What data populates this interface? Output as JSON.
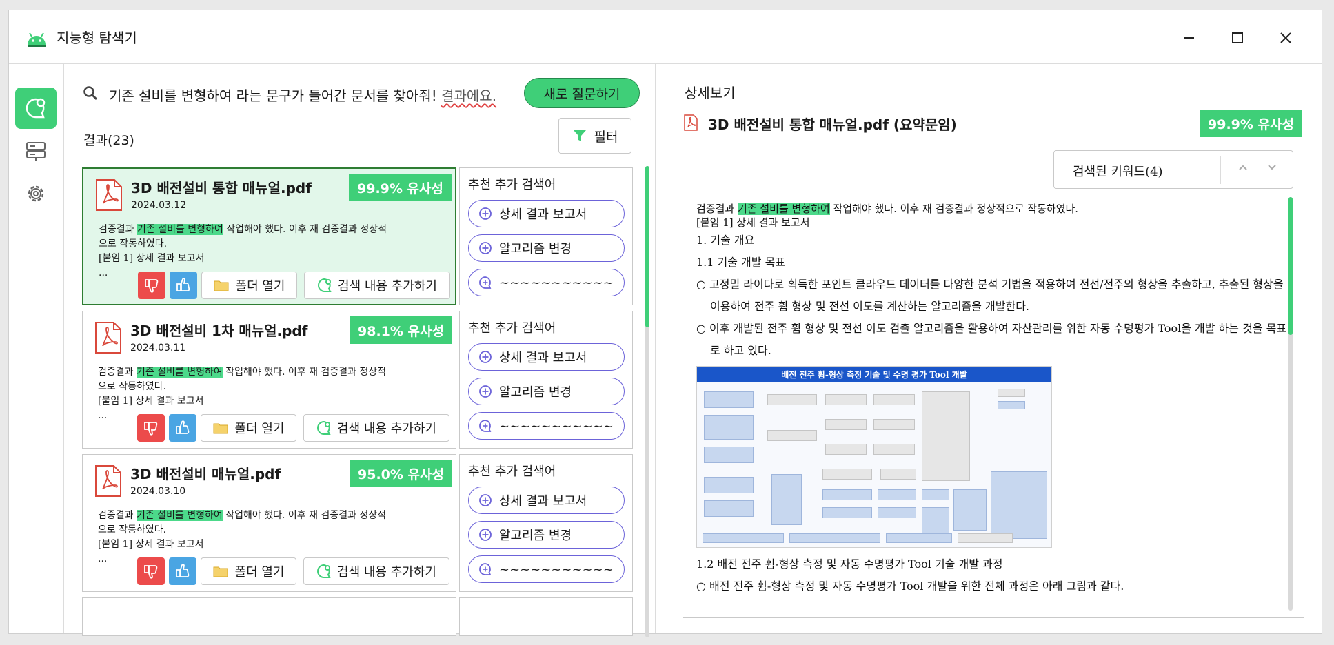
{
  "window": {
    "title": "지능형 탐색기"
  },
  "search": {
    "query": "기존 설비를 변형하여 라는 문구가 들어간 문서를 찾아줘!",
    "query_suffix": "결과에요.",
    "new_question_label": "새로 질문하기",
    "result_count": "결과(23)",
    "filter_label": "필터"
  },
  "results": [
    {
      "title": "3D 배전설비 통합 매뉴얼.pdf",
      "date": "2024.03.12",
      "similarity": "99.9% 유사성",
      "snippet_pre": "검증결과",
      "snippet_hl": "기존 설비를 변형하여",
      "snippet_post": "작업해야 했다. 이후 재 검증결과 정상적으로 작동하였다.",
      "snippet_line3": "[붙임 1] 상세 결과 보고서",
      "snippet_more": "...",
      "folder_label": "폴더 열기",
      "add_search_label": "검색 내용 추가하기"
    },
    {
      "title": "3D 배전설비 1차 매뉴얼.pdf",
      "date": "2024.03.11",
      "similarity": "98.1% 유사성",
      "snippet_pre": "검증결과",
      "snippet_hl": "기존 설비를 변형하여",
      "snippet_post": "작업해야 했다. 이후 재 검증결과 정상적으로 작동하였다.",
      "snippet_line3": "[붙임 1] 상세 결과 보고서",
      "snippet_more": "...",
      "folder_label": "폴더 열기",
      "add_search_label": "검색 내용 추가하기"
    },
    {
      "title": "3D 배전설비 매뉴얼.pdf",
      "date": "2024.03.10",
      "similarity": "95.0% 유사성",
      "snippet_pre": "검증결과",
      "snippet_hl": "기존 설비를 변형하여",
      "snippet_post": "작업해야 했다. 이후 재 검증결과 정상적으로 작동하였다.",
      "snippet_line3": "[붙임 1] 상세 결과 보고서",
      "snippet_more": "...",
      "folder_label": "폴더 열기",
      "add_search_label": "검색 내용 추가하기"
    }
  ],
  "recommendations": [
    {
      "title": "추천 추가 검색어",
      "items": [
        "상세 결과 보고서",
        "알고리즘 변경",
        "~~~~~~~~~~~"
      ]
    },
    {
      "title": "추천 추가 검색어",
      "items": [
        "상세 결과 보고서",
        "알고리즘 변경",
        "~~~~~~~~~~~"
      ]
    },
    {
      "title": "추천 추가 검색어",
      "items": [
        "상세 결과 보고서",
        "알고리즘 변경",
        "~~~~~~~~~~~"
      ]
    }
  ],
  "detail": {
    "heading": "상세보기",
    "doc_title": "3D 배전설비 통합 매뉴얼.pdf (요약문임)",
    "similarity": "99.9% 유사성",
    "keyword_label": "검색된 키워드(4)",
    "line1_pre": "검증결과",
    "line1_hl": "기존 설비를 변형하여",
    "line1_post": "작업해야 했다. 이후 재 검증결과 정상적으로 작동하였다.",
    "line2": "[붙임 1] 상세 결과 보고서",
    "sec1": "1. 기술 개요",
    "sec11": "1.1 기술 개발 목표",
    "bullet1": "○ 고정밀 라이다로 획득한 포인트 클라우드 데이터를 다양한 분석 기법을 적용하여 전선/전주의 형상을 추출하고, 추출된 형상을 이용하여 전주 휨 형상 및 전선 이도를 계산하는 알고리즘을 개발한다.",
    "bullet2": "○ 이후 개발된 전주 휨 형상 및 전선 이도 검출 알고리즘을 활용하여 자산관리를 위한 자동 수명평가 Tool을 개발 하는 것을 목표로 하고 있다.",
    "figure_title": "배전 전주 휨-형상 측정 기술 및 수명 평가 Tool 개발",
    "sec12": "1.2 배전 전주 휨-형상 측정 및 자동 수명평가 Tool 기술 개발 과정",
    "bullet3": "○ 배전 전주 휨-형상 측정 및 자동 수명평가 Tool 개발을 위한 전체 과정은 아래 그림과 같다."
  },
  "colors": {
    "accent": "#3fcf78",
    "dislike": "#ec4b4b",
    "like": "#4aa5e3",
    "chip_border": "#6c63d9"
  },
  "icons": {
    "search": "search-icon",
    "filter": "filter-icon",
    "pdf": "pdf-icon",
    "folder": "folder-icon"
  }
}
